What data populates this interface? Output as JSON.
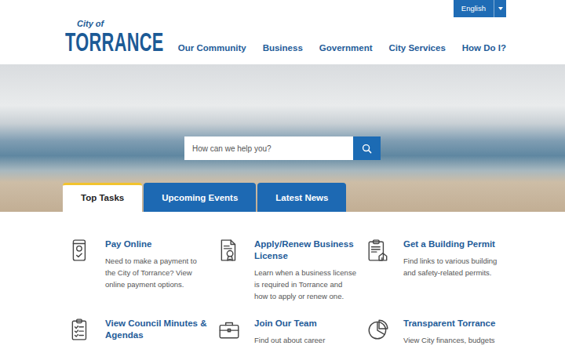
{
  "language": {
    "label": "English"
  },
  "logo": {
    "small": "City of",
    "large": "TORRANCE"
  },
  "nav": [
    "Our Community",
    "Business",
    "Government",
    "City Services",
    "How Do I?"
  ],
  "search": {
    "placeholder": "How can we help you?"
  },
  "tabs": [
    {
      "label": "Top Tasks",
      "selected": true
    },
    {
      "label": "Upcoming Events",
      "selected": false
    },
    {
      "label": "Latest News",
      "selected": false
    }
  ],
  "tasks": [
    {
      "kind": "payment",
      "title": "Pay Online",
      "description": "Need to make a payment to the City of Torrance? View online payment options."
    },
    {
      "kind": "license",
      "title": "Apply/Renew Business License",
      "description": "Learn when a business license is required in Torrance and how to apply or renew one."
    },
    {
      "kind": "permit",
      "title": "Get a Building Permit",
      "description": "Find links to various building and safety-related permits."
    },
    {
      "kind": "minutes",
      "title": "View Council Minutes & Agendas"
    },
    {
      "kind": "career",
      "title": "Join Our Team",
      "description": "Find out about career"
    },
    {
      "kind": "finance",
      "title": "Transparent Torrance",
      "description": "View City finances, budgets"
    }
  ]
}
